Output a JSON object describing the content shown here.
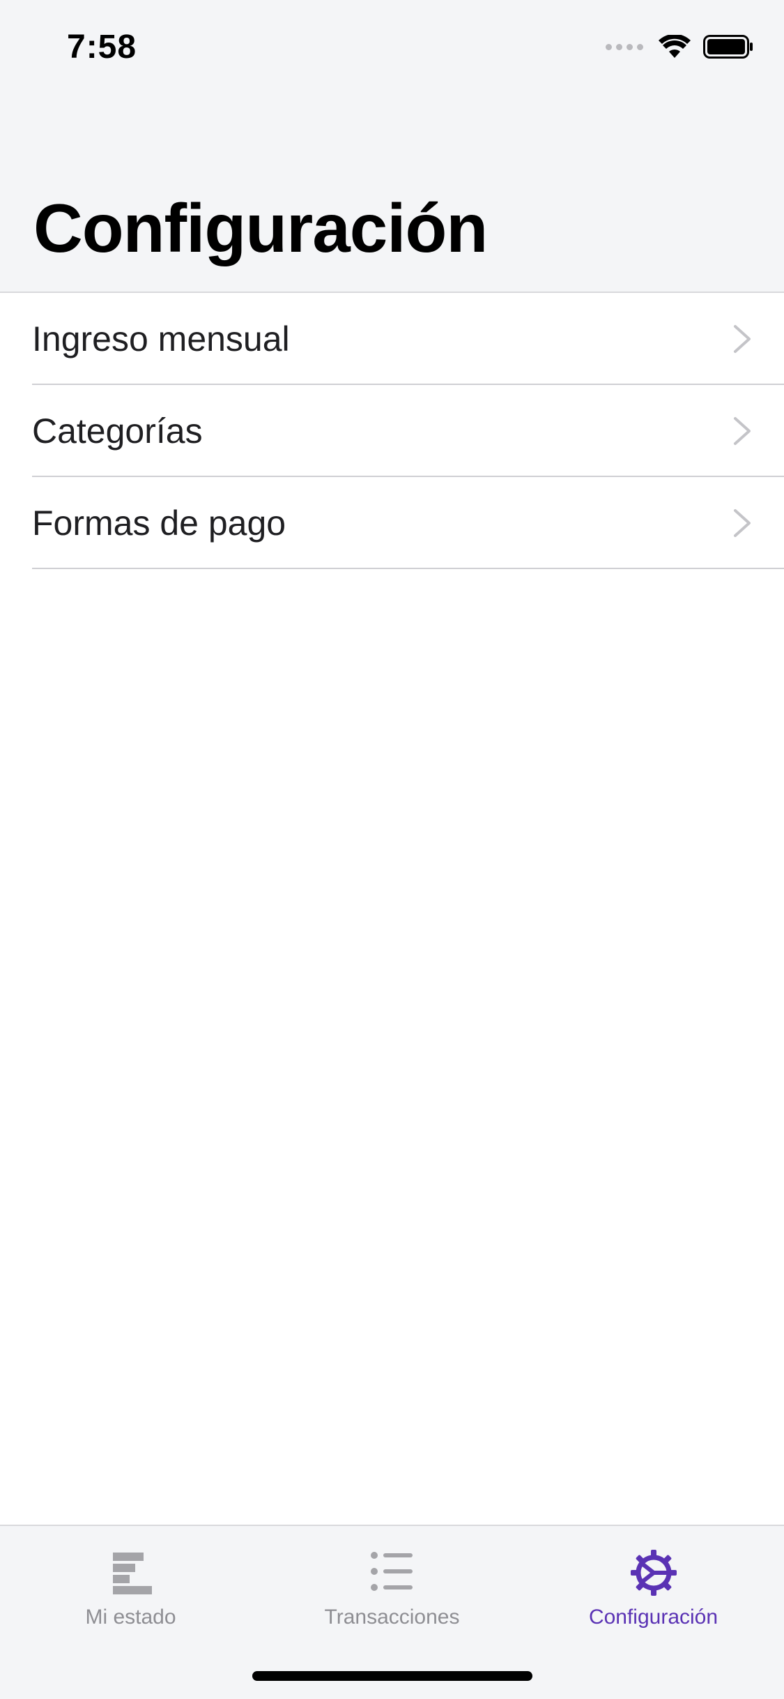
{
  "status_bar": {
    "time": "7:58"
  },
  "header": {
    "title": "Configuración"
  },
  "settings": {
    "items": [
      {
        "label": "Ingreso mensual",
        "icon": "chevron-right-icon"
      },
      {
        "label": "Categorías",
        "icon": "chevron-right-icon"
      },
      {
        "label": "Formas de pago",
        "icon": "chevron-right-icon"
      }
    ]
  },
  "tab_bar": {
    "tabs": [
      {
        "label": "Mi estado",
        "icon": "bar-chart-icon",
        "active": false
      },
      {
        "label": "Transacciones",
        "icon": "list-icon",
        "active": false
      },
      {
        "label": "Configuración",
        "icon": "gear-icon",
        "active": true
      }
    ]
  },
  "colors": {
    "accent": "#5a32b4",
    "inactive": "#8e8e93",
    "background_gray": "#f4f5f7"
  }
}
